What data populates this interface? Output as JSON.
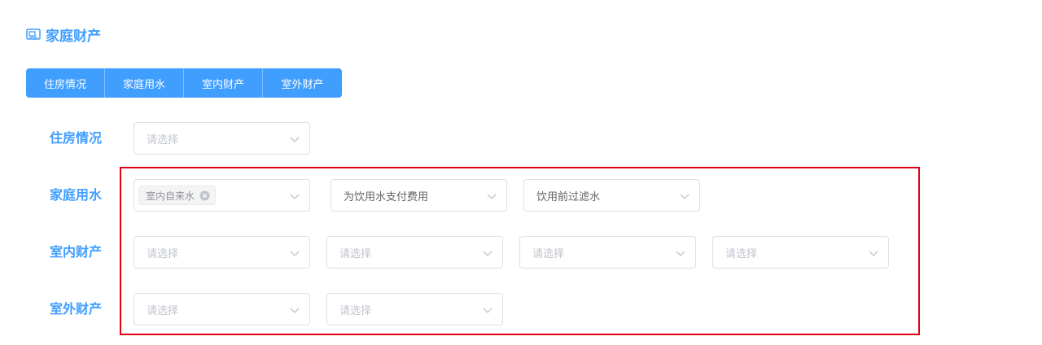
{
  "section": {
    "title": "家庭财产",
    "icon": "id-card-icon"
  },
  "tabs": [
    "住房情况",
    "家庭用水",
    "室内财产",
    "室外财产"
  ],
  "rows": {
    "housing": {
      "label": "住房情况",
      "select1": {
        "placeholder": "请选择"
      }
    },
    "water": {
      "label": "家庭用水",
      "select1": {
        "tag": "室内自来水"
      },
      "select2": {
        "value": "为饮用水支付费用"
      },
      "select3": {
        "value": "饮用前过滤水"
      }
    },
    "indoor": {
      "label": "室内财产",
      "select1": {
        "placeholder": "请选择"
      },
      "select2": {
        "placeholder": "请选择"
      },
      "select3": {
        "placeholder": "请选择"
      },
      "select4": {
        "placeholder": "请选择"
      }
    },
    "outdoor": {
      "label": "室外财产",
      "select1": {
        "placeholder": "请选择"
      },
      "select2": {
        "placeholder": "请选择"
      }
    }
  },
  "colors": {
    "accent": "#409eff",
    "highlight": "#e3000f"
  }
}
